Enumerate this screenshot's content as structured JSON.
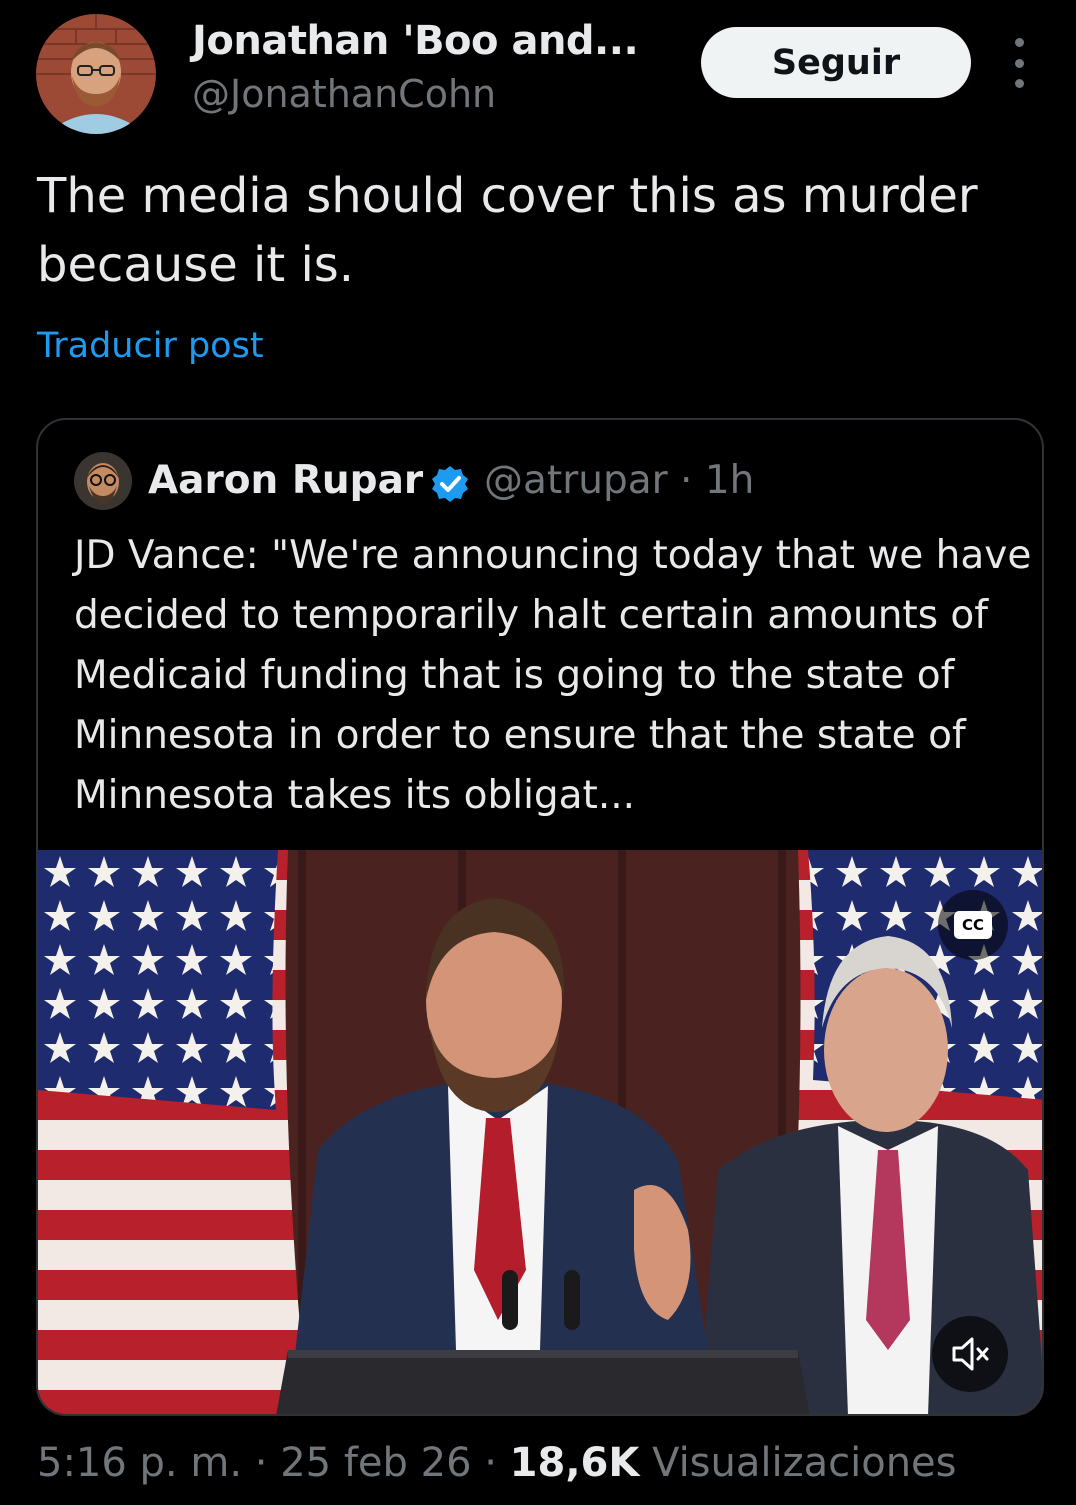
{
  "post": {
    "author_name": "Jonathan 'Boo and...",
    "author_handle": "@JonathanCohn",
    "follow_label": "Seguir",
    "text": "The media should cover this as murder because it is.",
    "translate_label": "Traducir post"
  },
  "quote": {
    "author_name": "Aaron Rupar",
    "author_handle": "@atrupar · 1h",
    "verified": true,
    "text": "JD Vance: \"We're announcing today that we have decided to temporarily halt certain amounts of Medicaid funding that is going to the state of Minnesota in order to ensure that the state of Minnesota takes its obligat...",
    "video": {
      "cc_label": "CC",
      "muted": true
    }
  },
  "meta": {
    "time": "5:16 p. m.",
    "separator": " · ",
    "date": "25 feb 26",
    "views_count": "18,6K",
    "views_label": "Visualizaciones"
  },
  "colors": {
    "background": "#000000",
    "text": "#e7e9ea",
    "secondary": "#71767b",
    "link": "#1d9bf0",
    "border": "#2f3336",
    "verified": "#1d9bf0"
  },
  "icons": [
    "more-vertical-icon",
    "verified-badge-icon",
    "closed-captions-icon",
    "volume-muted-icon"
  ]
}
